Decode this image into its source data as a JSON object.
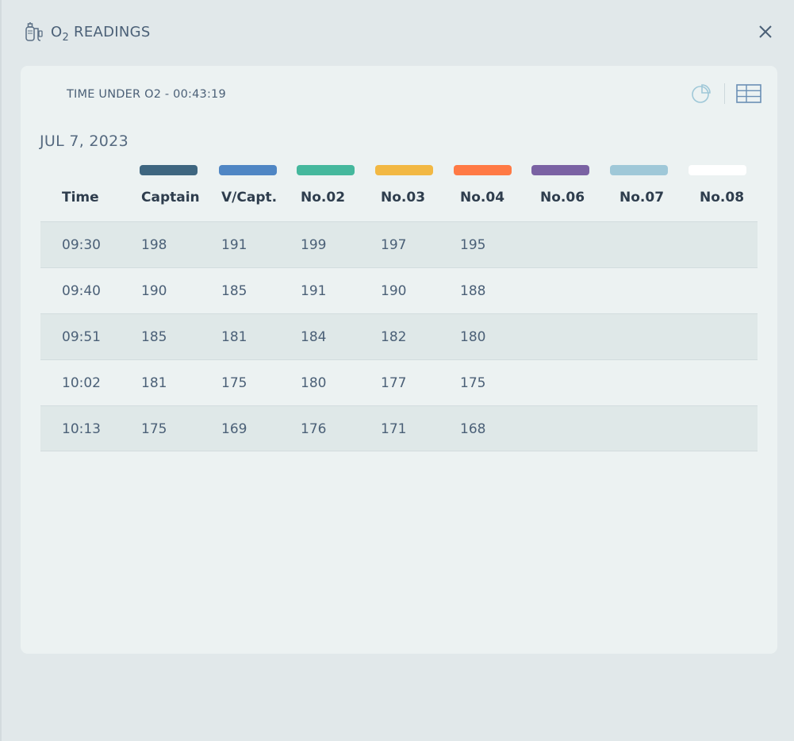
{
  "header": {
    "title_main": "O",
    "title_sub": "2",
    "title_rest": "READINGS"
  },
  "panel": {
    "time_under_label": "TIME UNDER O2 - 00:43:19",
    "date": "JUL 7, 2023"
  },
  "columns": [
    {
      "label": "Time",
      "color": null
    },
    {
      "label": "Captain",
      "color": "#3e6680"
    },
    {
      "label": "V/Capt.",
      "color": "#4f86c4"
    },
    {
      "label": "No.02",
      "color": "#45b89d"
    },
    {
      "label": "No.03",
      "color": "#f2b843"
    },
    {
      "label": "No.04",
      "color": "#ff7a45"
    },
    {
      "label": "No.06",
      "color": "#7a62a3"
    },
    {
      "label": "No.07",
      "color": "#9fc8d8"
    },
    {
      "label": "No.08",
      "color": "#ffffff"
    }
  ],
  "rows": [
    {
      "time": "09:30",
      "values": [
        "198",
        "191",
        "199",
        "197",
        "195",
        "",
        "",
        ""
      ]
    },
    {
      "time": "09:40",
      "values": [
        "190",
        "185",
        "191",
        "190",
        "188",
        "",
        "",
        ""
      ]
    },
    {
      "time": "09:51",
      "values": [
        "185",
        "181",
        "184",
        "182",
        "180",
        "",
        "",
        ""
      ]
    },
    {
      "time": "10:02",
      "values": [
        "181",
        "175",
        "180",
        "177",
        "175",
        "",
        "",
        ""
      ]
    },
    {
      "time": "10:13",
      "values": [
        "175",
        "169",
        "176",
        "171",
        "168",
        "",
        "",
        ""
      ]
    }
  ],
  "icons": {
    "title": "oxygen-tank-icon",
    "close": "close-icon",
    "chart_view": "pie-chart-icon",
    "table_view": "table-icon"
  }
}
